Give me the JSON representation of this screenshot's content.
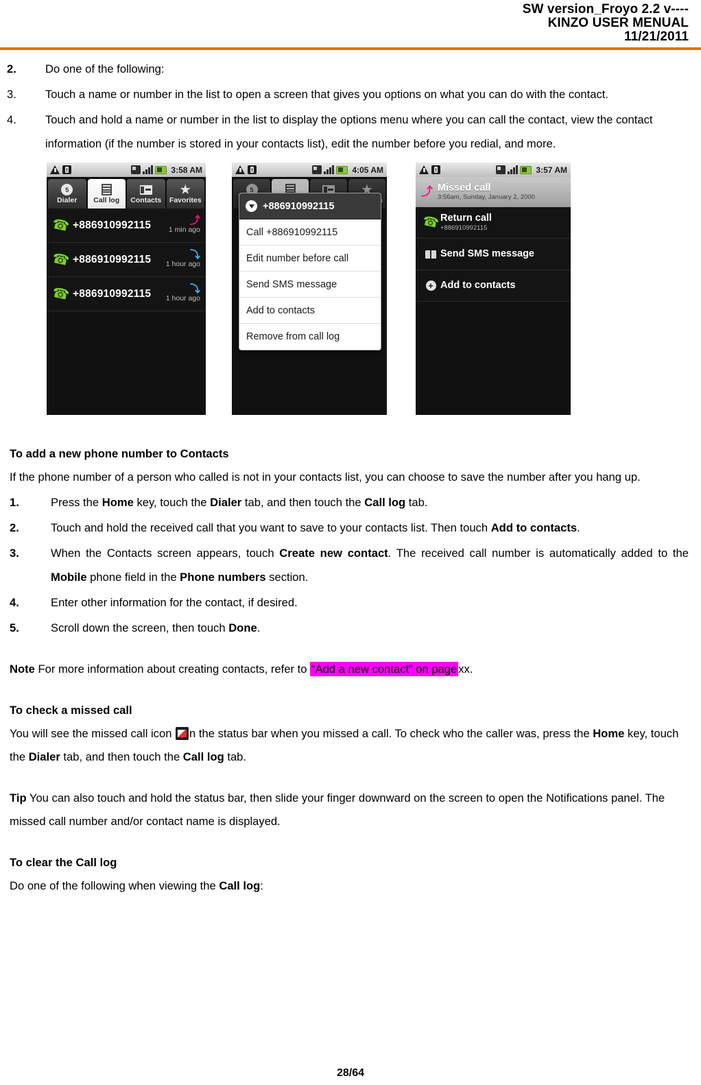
{
  "header": {
    "line1": "SW version_Froyo 2.2 v----",
    "line2": "KINZO USER MENUAL",
    "line3": "11/21/2011",
    "rule_color": "#ee6f06"
  },
  "steps_top": [
    {
      "marker": "2.",
      "marker_bold": true,
      "text": "Do one of the following:"
    },
    {
      "marker": "3.",
      "marker_bold": false,
      "text": "Touch a name or number in the list to open a screen that gives you options on what you can do with the contact."
    },
    {
      "marker": "4.",
      "marker_bold": false,
      "text": "Touch and hold a name or number in the list to display the options menu where you can call the contact, view the contact information (if the number is stored in your contacts list), edit the number before you redial, and more."
    }
  ],
  "screenshots": {
    "phone1": {
      "statusbar": {
        "time": "3:58 AM",
        "icons": [
          "warning-icon",
          "usb-icon",
          "sim-icon",
          "signal-bars-icon",
          "battery-icon"
        ]
      },
      "tabs": [
        {
          "label": "Dialer",
          "icon": "dialer-icon",
          "badge": "5",
          "active": false
        },
        {
          "label": "Call log",
          "icon": "call-log-icon",
          "active": true
        },
        {
          "label": "Contacts",
          "icon": "contacts-icon",
          "active": false
        },
        {
          "label": "Favorites",
          "icon": "star-icon",
          "active": false
        }
      ],
      "rows": [
        {
          "number": "+886910992115",
          "ago": "1 min ago",
          "type": "missed"
        },
        {
          "number": "+886910992115",
          "ago": "1 hour ago",
          "type": "incoming"
        },
        {
          "number": "+886910992115",
          "ago": "1 hour ago",
          "type": "incoming"
        }
      ]
    },
    "phone2": {
      "statusbar": {
        "time": "4:05 AM"
      },
      "tabs": [
        {
          "label": "Dialer",
          "active": false
        },
        {
          "label": "Call log",
          "active": true
        },
        {
          "label": "Contacts",
          "active": false
        },
        {
          "label": "Favorites",
          "active": false
        }
      ],
      "dialog": {
        "title": "+886910992115",
        "items": [
          "Call +886910992115",
          "Edit number before call",
          "Send SMS message",
          "Add to contacts",
          "Remove from call log"
        ]
      }
    },
    "phone3": {
      "statusbar": {
        "time": "3:57 AM"
      },
      "notification": {
        "title": "Missed call",
        "subtitle": "3:56am, Sunday, January 2, 2000"
      },
      "actions": [
        {
          "title": "Return call",
          "subtitle": "+886910992115",
          "icon": "phone-icon"
        },
        {
          "title": "Send SMS message",
          "subtitle": "",
          "icon": "sms-icon"
        },
        {
          "title": "Add to contacts",
          "subtitle": "",
          "icon": "add-icon"
        }
      ]
    }
  },
  "section_add": {
    "heading": "To add a new phone number to Contacts",
    "intro": "If the phone number of a person who called is not in your contacts list, you can choose to save the number after you hang up.",
    "steps": [
      {
        "marker": "1.",
        "parts": [
          {
            "t": "Press the ",
            "b": false
          },
          {
            "t": "Home",
            "b": true
          },
          {
            "t": " key, touch the ",
            "b": false
          },
          {
            "t": "Dialer",
            "b": true
          },
          {
            "t": " tab, and then touch the ",
            "b": false
          },
          {
            "t": "Call log",
            "b": true
          },
          {
            "t": " tab.",
            "b": false
          }
        ]
      },
      {
        "marker": "2.",
        "parts": [
          {
            "t": "Touch and hold the received call that you want to save to your contacts list. Then touch ",
            "b": false
          },
          {
            "t": "Add to contacts",
            "b": true
          },
          {
            "t": ".",
            "b": false
          }
        ]
      },
      {
        "marker": "3.",
        "parts": [
          {
            "t": "When the Contacts screen appears, touch ",
            "b": false
          },
          {
            "t": "Create new contact",
            "b": true
          },
          {
            "t": ". The received call number is automatically added to the ",
            "b": false
          },
          {
            "t": "Mobile",
            "b": true
          },
          {
            "t": " phone field in the ",
            "b": false
          },
          {
            "t": "Phone numbers",
            "b": true
          },
          {
            "t": " section.",
            "b": false
          }
        ]
      },
      {
        "marker": "4.",
        "parts": [
          {
            "t": "Enter other information for the contact, if desired.",
            "b": false
          }
        ]
      },
      {
        "marker": "5.",
        "parts": [
          {
            "t": "Scroll down the screen, then touch ",
            "b": false
          },
          {
            "t": "Done",
            "b": true
          },
          {
            "t": ".",
            "b": false
          }
        ]
      }
    ]
  },
  "note": {
    "label": "Note",
    "before": " For more information about creating contacts, refer to ",
    "highlight": "“Add a new contact” on page",
    "after": "xx.",
    "highlight_color": "#ff00ff"
  },
  "section_missed": {
    "heading": "To check a missed call",
    "before_icon": "You will see the missed call icon ",
    "icon": "missed-call-icon",
    "after_icon_parts": [
      {
        "t": "n the status bar when you missed a call. To check who the caller was, press the ",
        "b": false
      },
      {
        "t": "Home",
        "b": true
      },
      {
        "t": " key, touch the ",
        "b": false
      },
      {
        "t": "Dialer",
        "b": true
      },
      {
        "t": " tab, and then touch the ",
        "b": false
      },
      {
        "t": "Call log",
        "b": true
      },
      {
        "t": " tab.",
        "b": false
      }
    ]
  },
  "tip": {
    "label": "Tip",
    "text": " You can also touch and hold the status bar, then slide your finger downward on the screen to open the Notifications panel. The missed call number and/or contact name is displayed."
  },
  "section_clear": {
    "heading": "To clear the Call log",
    "parts": [
      {
        "t": "Do one of the following when viewing the ",
        "b": false
      },
      {
        "t": "Call log",
        "b": true
      },
      {
        "t": ":",
        "b": false
      }
    ]
  },
  "footer": {
    "page": "28/64"
  }
}
